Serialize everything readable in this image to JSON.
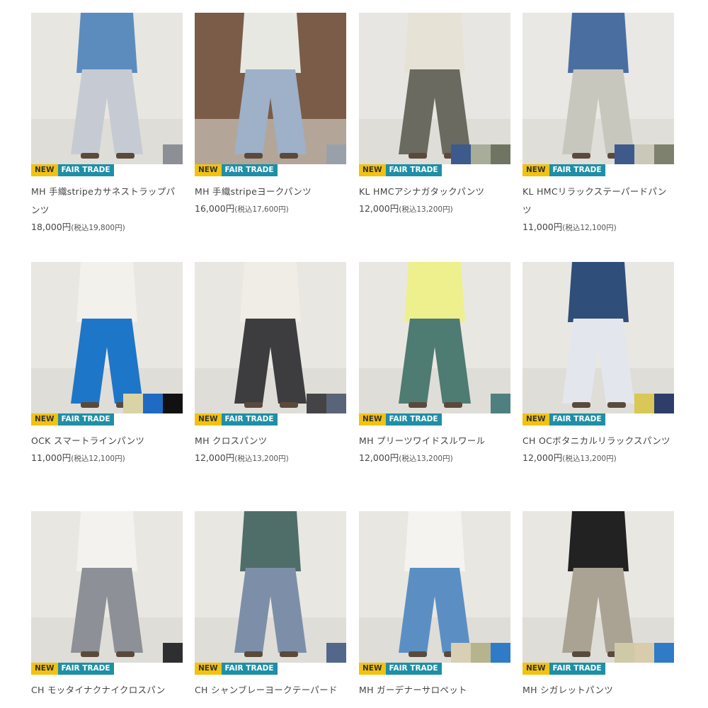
{
  "products": [
    {
      "badge_new": "NEW",
      "badge_ft": "FAIR TRADE",
      "name": "MH 手織stripeカサネストラップパンツ",
      "price": "18,000円",
      "tax": "(税込19,800円)",
      "swatches": [
        "#8c8f95"
      ],
      "pants": "#c6cbd3",
      "top": "#5c8cbe",
      "bg": "#e8e6e1"
    },
    {
      "badge_new": "NEW",
      "badge_ft": "FAIR TRADE",
      "name": "MH 手織stripeヨークパンツ",
      "price": "16,000円",
      "tax": "(税込17,600円)",
      "swatches": [
        "#9aa0aa"
      ],
      "pants": "#9fb0c9",
      "top": "#e8e8e3",
      "bg": "#7a5c48"
    },
    {
      "badge_new": "NEW",
      "badge_ft": "FAIR TRADE",
      "name": "KL HMCアシナガタックパンツ",
      "price": "12,000円",
      "tax": "(税込13,200円)",
      "swatches": [
        "#3e5a8c",
        "#a8ad9a",
        "#6f7562"
      ],
      "pants": "#6a6a60",
      "top": "#e6e2d6",
      "bg": "#e7e6e2"
    },
    {
      "badge_new": "NEW",
      "badge_ft": "FAIR TRADE",
      "name": "KL HMCリラックステーパードパンツ",
      "price": "11,000円",
      "tax": "(税込12,100円)",
      "swatches": [
        "#3e5a8c",
        "#c9c8b9",
        "#7d816d"
      ],
      "pants": "#c8c7bd",
      "top": "#4a6ea0",
      "bg": "#e9e8e4"
    },
    {
      "badge_new": "NEW",
      "badge_ft": "FAIR TRADE",
      "name": "OCK スマートラインパンツ",
      "price": "11,000円",
      "tax": "(税込12,100円)",
      "swatches": [
        "#d9d3a6",
        "#1f6bc4",
        "#111111"
      ],
      "pants": "#1e76c8",
      "top": "#f2f1ec",
      "bg": "#e9e7e2"
    },
    {
      "badge_new": "NEW",
      "badge_ft": "FAIR TRADE",
      "name": "MH クロスパンツ",
      "price": "12,000円",
      "tax": "(税込13,200円)",
      "swatches": [
        "#444446",
        "#5a6478"
      ],
      "pants": "#3d3d3f",
      "top": "#efede6",
      "bg": "#e9e7e2"
    },
    {
      "badge_new": "NEW",
      "badge_ft": "FAIR TRADE",
      "name": "MH プリーツワイドスルワール",
      "price": "12,000円",
      "tax": "(税込13,200円)",
      "swatches": [
        "#4f8080"
      ],
      "pants": "#4e7b72",
      "top": "#eef08e",
      "bg": "#e9e7e2"
    },
    {
      "badge_new": "NEW",
      "badge_ft": "FAIR TRADE",
      "name": "CH OCボタニカルリラックスパンツ",
      "price": "12,000円",
      "tax": "(税込13,200円)",
      "swatches": [
        "#d9c756",
        "#2e3d6a"
      ],
      "pants": "#e4e6ee",
      "top": "#2f4e7a",
      "bg": "#e9e7e2"
    },
    {
      "badge_new": "NEW",
      "badge_ft": "FAIR TRADE",
      "name": "CH モッタイナクナイクロスパン",
      "price": "",
      "tax": "",
      "swatches": [
        "#2e2f31"
      ],
      "pants": "#8d9096",
      "top": "#f3f2ee",
      "bg": "#e9e7e2"
    },
    {
      "badge_new": "NEW",
      "badge_ft": "FAIR TRADE",
      "name": "CH シャンブレーヨークテーパード",
      "price": "",
      "tax": "",
      "swatches": [
        "#52678a"
      ],
      "pants": "#7d8fa8",
      "top": "#4f6e6a",
      "bg": "#e9e7e2"
    },
    {
      "badge_new": "NEW",
      "badge_ft": "FAIR TRADE",
      "name": "MH ガーデナーサロペット",
      "price": "",
      "tax": "",
      "swatches": [
        "#d8cfb5",
        "#b5b48c",
        "#2f7bc8"
      ],
      "pants": "#5b8fc4",
      "top": "#f4f3ef",
      "bg": "#e9e7e2"
    },
    {
      "badge_new": "NEW",
      "badge_ft": "FAIR TRADE",
      "name": "MH シガレットパンツ",
      "price": "",
      "tax": "",
      "swatches": [
        "#cfc9a7",
        "#d8ccad",
        "#2f7bc8"
      ],
      "pants": "#aaa394",
      "top": "#222222",
      "bg": "#e9e7e2"
    }
  ]
}
